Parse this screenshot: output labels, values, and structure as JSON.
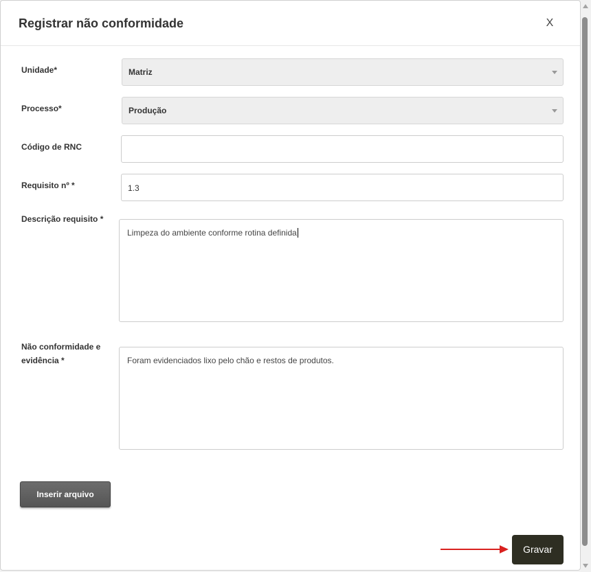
{
  "dialog": {
    "title": "Registrar não conformidade",
    "close_label": "X"
  },
  "form": {
    "unidade": {
      "label": "Unidade",
      "required_mark": "*",
      "value": "Matriz"
    },
    "processo": {
      "label": "Processo",
      "required_mark": "*",
      "value": "Produção"
    },
    "codigo_rnc": {
      "label": "Código de RNC",
      "value": ""
    },
    "requisito": {
      "label": "Requisito nº *",
      "value": "1.3"
    },
    "descricao": {
      "label": "Descrição requisito *",
      "value": "Limpeza do ambiente conforme rotina definida"
    },
    "nao_conformidade": {
      "label_line1": "Não conformidade e",
      "label_line2": "evidência *",
      "value": "Foram evidenciados lixo pelo chão e restos de produtos."
    }
  },
  "buttons": {
    "insert_file": "Inserir arquivo",
    "save": "Gravar"
  },
  "colors": {
    "save_button": "#2e2e22",
    "annotation_arrow": "#d9211f"
  }
}
